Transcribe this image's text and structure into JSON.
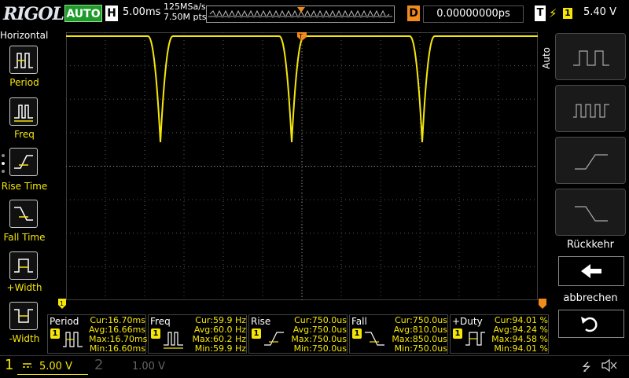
{
  "header": {
    "brand": "RIGOL",
    "run_mode": "AUTO",
    "timebase_label": "H",
    "timebase_value": "5.00ms",
    "sample_rate": "125MSa/s",
    "memory_depth": "7.50M pts",
    "delay_label": "D",
    "delay_value": "0.00000000ps",
    "trigger_label": "T",
    "trigger_source": "1",
    "trigger_level": "5.40 V"
  },
  "left_menu": {
    "title": "Horizontal",
    "items": [
      {
        "label": "Period",
        "icon": "period-icon"
      },
      {
        "label": "Freq",
        "icon": "freq-icon"
      },
      {
        "label": "Rise Time",
        "icon": "rise-time-icon"
      },
      {
        "label": "Fall Time",
        "icon": "fall-time-icon"
      },
      {
        "label": "+Width",
        "icon": "positive-width-icon"
      },
      {
        "label": "-Width",
        "icon": "negative-width-icon"
      }
    ]
  },
  "right_menu": {
    "mode_label": "Auto",
    "keys": [
      {
        "icon": "square-wave-icon"
      },
      {
        "icon": "dense-square-wave-icon"
      },
      {
        "icon": "rising-edge-icon"
      },
      {
        "icon": "falling-edge-icon"
      }
    ],
    "back_label": "Rückkehr",
    "cancel_label": "abbrechen"
  },
  "measurements": [
    {
      "name": "Period",
      "ch": "1",
      "cur": "Cur:16.70ms",
      "avg": "Avg:16.66ms",
      "max": "Max:16.70ms",
      "min": "Min:16.60ms"
    },
    {
      "name": "Freq",
      "ch": "1",
      "cur": "Cur:59.9 Hz",
      "avg": "Avg:60.0 Hz",
      "max": "Max:60.2 Hz",
      "min": "Min:59.9 Hz"
    },
    {
      "name": "Rise",
      "ch": "1",
      "cur": "Cur:750.0us",
      "avg": "Avg:750.0us",
      "max": "Max:750.0us",
      "min": "Min:750.0us"
    },
    {
      "name": "Fall",
      "ch": "1",
      "cur": "Cur:750.0us",
      "avg": "Avg:810.0us",
      "max": "Max:850.0us",
      "min": "Min:750.0us"
    },
    {
      "name": "+Duty",
      "ch": "1",
      "cur": "Cur:94.01 %",
      "avg": "Avg:94.24 %",
      "max": "Max:94.58 %",
      "min": "Min:94.01 %"
    }
  ],
  "channels": {
    "ch1": {
      "number": "1",
      "scale": "5.00 V",
      "color": "#f5e60a"
    },
    "ch2": {
      "number": "2",
      "scale": "1.00 V",
      "color": "#555555"
    }
  },
  "colors": {
    "trace": "#f5e60a",
    "trigger": "#f28b1c",
    "auto_button": "#1e9a2a"
  }
}
